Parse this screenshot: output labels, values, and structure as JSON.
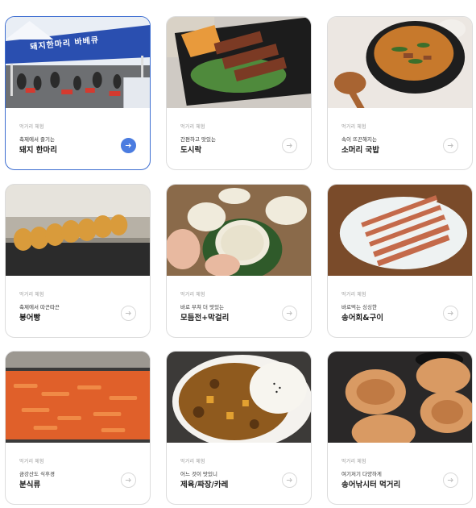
{
  "cards": [
    {
      "category": "먹거리 체험",
      "desc": "축제에서 즐기는",
      "title": "돼지 한마리",
      "photo": "bbq-tent-photo",
      "active": true,
      "sign": "돼지한마리 바베큐"
    },
    {
      "category": "먹거리 체험",
      "desc": "간편하고 맛있는",
      "title": "도시락",
      "photo": "lunchbox-photo",
      "active": false
    },
    {
      "category": "먹거리 체험",
      "desc": "속이 뜨끈해지는",
      "title": "소머리 국밥",
      "photo": "soup-photo",
      "active": false
    },
    {
      "category": "먹거리 체험",
      "desc": "축제에서 따끈따끈",
      "title": "붕어빵",
      "photo": "fish-bread-photo",
      "active": false
    },
    {
      "category": "먹거리 체험",
      "desc": "바로 부쳐 더 맛있는",
      "title": "모듬전+막걸리",
      "photo": "makgeolli-photo",
      "active": false
    },
    {
      "category": "먹거리 체험",
      "desc": "바로먹는 싱싱한",
      "title": "송어회&구이",
      "photo": "trout-photo",
      "active": false
    },
    {
      "category": "먹거리 체험",
      "desc": "금강산도 식후경",
      "title": "분식류",
      "photo": "tteokbokki-photo",
      "active": false
    },
    {
      "category": "먹거리 체험",
      "desc": "어느 것이 맛있니",
      "title": "제육/짜장/카레",
      "photo": "curry-photo",
      "active": false
    },
    {
      "category": "먹거리 체험",
      "desc": "여기저기 다양하게",
      "title": "송어낚시터 먹거리",
      "photo": "hotteok-photo",
      "active": false
    }
  ],
  "colors": {
    "accent": "#4b7ce0",
    "border_active": "#3f6fd1"
  },
  "icons": {
    "arrow": "arrow-right-icon"
  }
}
